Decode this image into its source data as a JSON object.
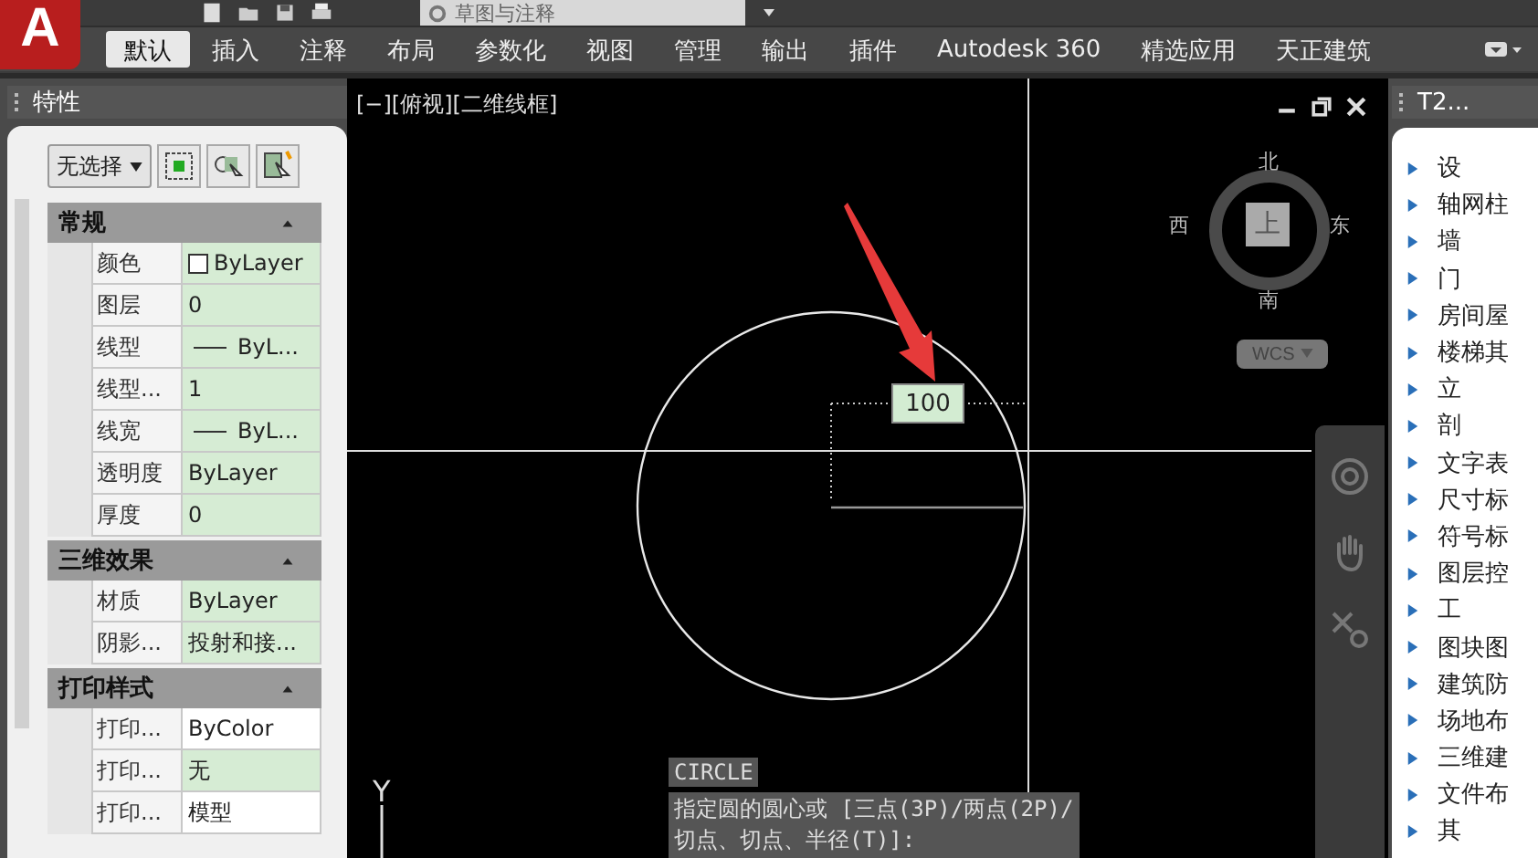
{
  "app_logo": "A",
  "quick_access": {
    "workspace": "草图与注释"
  },
  "ribbon_tabs": [
    {
      "label": "默认",
      "selected": true
    },
    {
      "label": "插入",
      "selected": false
    },
    {
      "label": "注释",
      "selected": false
    },
    {
      "label": "布局",
      "selected": false
    },
    {
      "label": "参数化",
      "selected": false
    },
    {
      "label": "视图",
      "selected": false
    },
    {
      "label": "管理",
      "selected": false
    },
    {
      "label": "输出",
      "selected": false
    },
    {
      "label": "插件",
      "selected": false
    },
    {
      "label": "Autodesk 360",
      "selected": false
    },
    {
      "label": "精选应用",
      "selected": false
    },
    {
      "label": "天正建筑",
      "selected": false
    }
  ],
  "properties_panel": {
    "title": "特性",
    "selection": "无选择",
    "sections": [
      {
        "title": "常规",
        "expanded": true,
        "rows": [
          {
            "label": "颜色",
            "value": "ByLayer",
            "kind": "color",
            "highlighted": true
          },
          {
            "label": "图层",
            "value": "0",
            "kind": "text",
            "highlighted": true
          },
          {
            "label": "线型",
            "value": "ByL...",
            "kind": "line",
            "highlighted": true
          },
          {
            "label": "线型...",
            "value": "1",
            "kind": "text",
            "highlighted": true
          },
          {
            "label": "线宽",
            "value": "ByL...",
            "kind": "line",
            "highlighted": true
          },
          {
            "label": "透明度",
            "value": "ByLayer",
            "kind": "text",
            "highlighted": true
          },
          {
            "label": "厚度",
            "value": "0",
            "kind": "text",
            "highlighted": true
          }
        ]
      },
      {
        "title": "三维效果",
        "expanded": true,
        "rows": [
          {
            "label": "材质",
            "value": "ByLayer",
            "kind": "text",
            "highlighted": true
          },
          {
            "label": "阴影...",
            "value": "投射和接...",
            "kind": "text",
            "highlighted": true
          }
        ]
      },
      {
        "title": "打印样式",
        "expanded": true,
        "rows": [
          {
            "label": "打印...",
            "value": "ByColor",
            "kind": "text",
            "highlighted": false
          },
          {
            "label": "打印...",
            "value": "无",
            "kind": "text",
            "highlighted": true
          },
          {
            "label": "打印...",
            "value": "模型",
            "kind": "text",
            "highlighted": false
          }
        ]
      }
    ]
  },
  "viewport": {
    "label": "[−][俯视][二维线框]",
    "viewcube": {
      "north": "北",
      "south": "南",
      "east": "东",
      "west": "西",
      "face": "上"
    },
    "wcs": "WCS",
    "dynamic_input": "100",
    "ucs_axis": "Y",
    "command": {
      "name": "CIRCLE",
      "prompt_lines": [
        "指定圆的圆心或 [三点(3P)/两点(2P)/",
        "切点、切点、半径(T)]:"
      ]
    }
  },
  "tool_palette": {
    "title": "T2...",
    "items": [
      "设",
      "轴网柱",
      "墙",
      "门",
      "房间屋",
      "楼梯其",
      "立",
      "剖",
      "文字表",
      "尺寸标",
      "符号标",
      "图层控",
      "工",
      "图块图",
      "建筑防",
      "场地布",
      "三维建",
      "文件布",
      "其"
    ]
  }
}
